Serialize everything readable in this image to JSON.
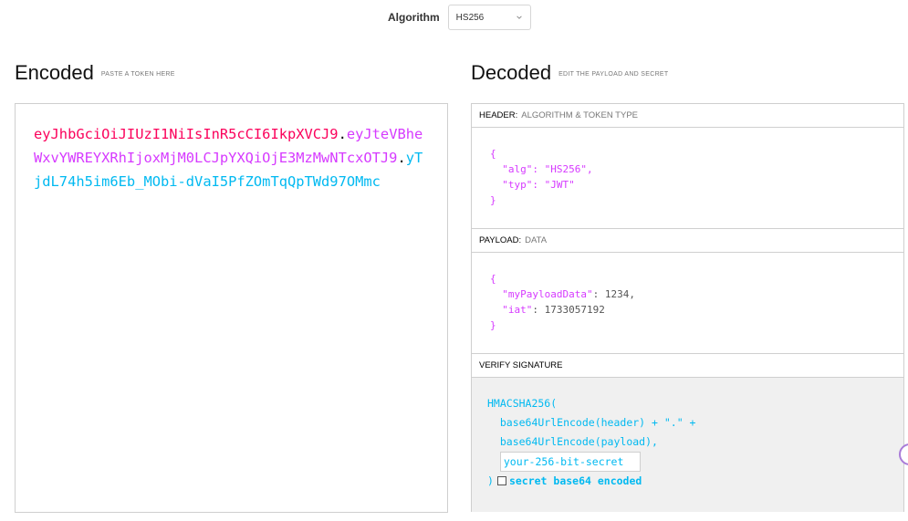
{
  "algorithm": {
    "label": "Algorithm",
    "selected": "HS256"
  },
  "encoded": {
    "title": "Encoded",
    "subtitle": "PASTE A TOKEN HERE",
    "token": {
      "header": "eyJhbGciOiJIUzI1NiIsInR5cCI6IkpXVCJ9",
      "dot1": ".",
      "payload": "eyJteVBheWxvYWREYXRhIjoxMjM0LCJpYXQiOjE3MzMwNTcxOTJ9",
      "dot2": ".",
      "signature": "yTjdL74h5im6Eb_MObi-dVaI5PfZOmTqQpTWd97OMmc"
    },
    "colors": {
      "header": "#fb015b",
      "payload": "#d63aff",
      "signature": "#00b9f1"
    }
  },
  "decoded": {
    "title": "Decoded",
    "subtitle": "EDIT THE PAYLOAD AND SECRET",
    "header_section": {
      "label": "HEADER:",
      "sublabel": "ALGORITHM & TOKEN TYPE",
      "lines": [
        "{",
        "  \"alg\": \"HS256\",",
        "  \"typ\": \"JWT\"",
        "}"
      ]
    },
    "payload_section": {
      "label": "PAYLOAD:",
      "sublabel": "DATA",
      "open": "{",
      "key1": "  \"myPayloadData\"",
      "val1": ": 1234,",
      "key2": "  \"iat\"",
      "val2": ": 1733057192",
      "close": "}"
    },
    "signature_section": {
      "label": "VERIFY SIGNATURE",
      "line1": "HMACSHA256(",
      "line2": "  base64UrlEncode(header) + \".\" +",
      "line3": "  base64UrlEncode(payload),",
      "secret_placeholder": "your-256-bit-secret",
      "close": ")",
      "checkbox_label": "secret base64 encoded"
    }
  }
}
